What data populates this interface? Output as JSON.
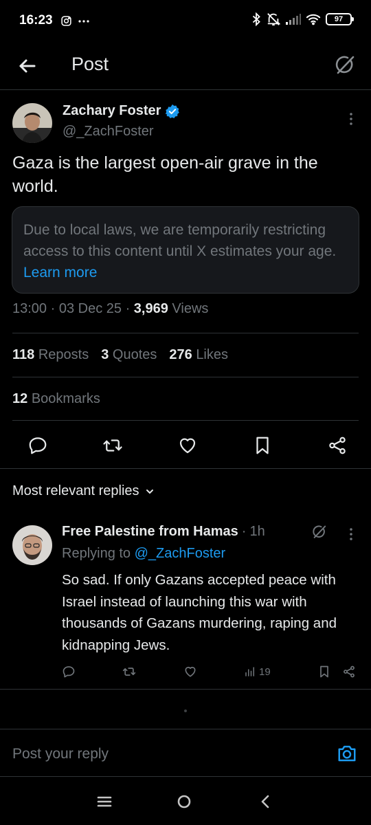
{
  "status_bar": {
    "time": "16:23",
    "battery": "97",
    "icons": [
      "instagram-icon",
      "more-dots-icon",
      "bluetooth-icon",
      "mute-icon",
      "signal-icon",
      "wifi-icon",
      "battery-icon"
    ]
  },
  "header": {
    "title": "Post",
    "icons": [
      "back-arrow-icon",
      "grok-icon"
    ]
  },
  "post": {
    "author_name": "Zachary Foster",
    "author_handle": "@_ZachFoster",
    "verified": true,
    "text": "Gaza is the largest open-air grave in the world.",
    "restricted_notice": "Due to local laws, we are temporarily restricting access to this content until X estimates your age.",
    "learn_more": "Learn more",
    "time": "13:00",
    "date": "03 Dec 25",
    "views_count": "3,969",
    "views_label": "Views",
    "reposts_count": "118",
    "reposts_label": "Reposts",
    "quotes_count": "3",
    "quotes_label": "Quotes",
    "likes_count": "276",
    "likes_label": "Likes",
    "bookmarks_count": "12",
    "bookmarks_label": "Bookmarks",
    "actions": [
      "reply-icon",
      "repost-icon",
      "like-icon",
      "bookmark-icon",
      "share-icon"
    ]
  },
  "replies": {
    "sort_label": "Most relevant replies",
    "items": [
      {
        "author_name": "Free Palestine from Hamas",
        "time": "1h",
        "replying_prefix": "Replying to",
        "replying_to": "@_ZachFoster",
        "text": "So sad. If only Gazans accepted peace with Israel instead of launching this war with thousands of Gazans murdering, raping and kidnapping Jews.",
        "views": "19"
      }
    ]
  },
  "composer": {
    "placeholder": "Post your reply"
  },
  "colors": {
    "background": "#000000",
    "text": "#e7e9ea",
    "muted": "#71767b",
    "accent": "#1d9bf0",
    "border": "#2f3336"
  }
}
